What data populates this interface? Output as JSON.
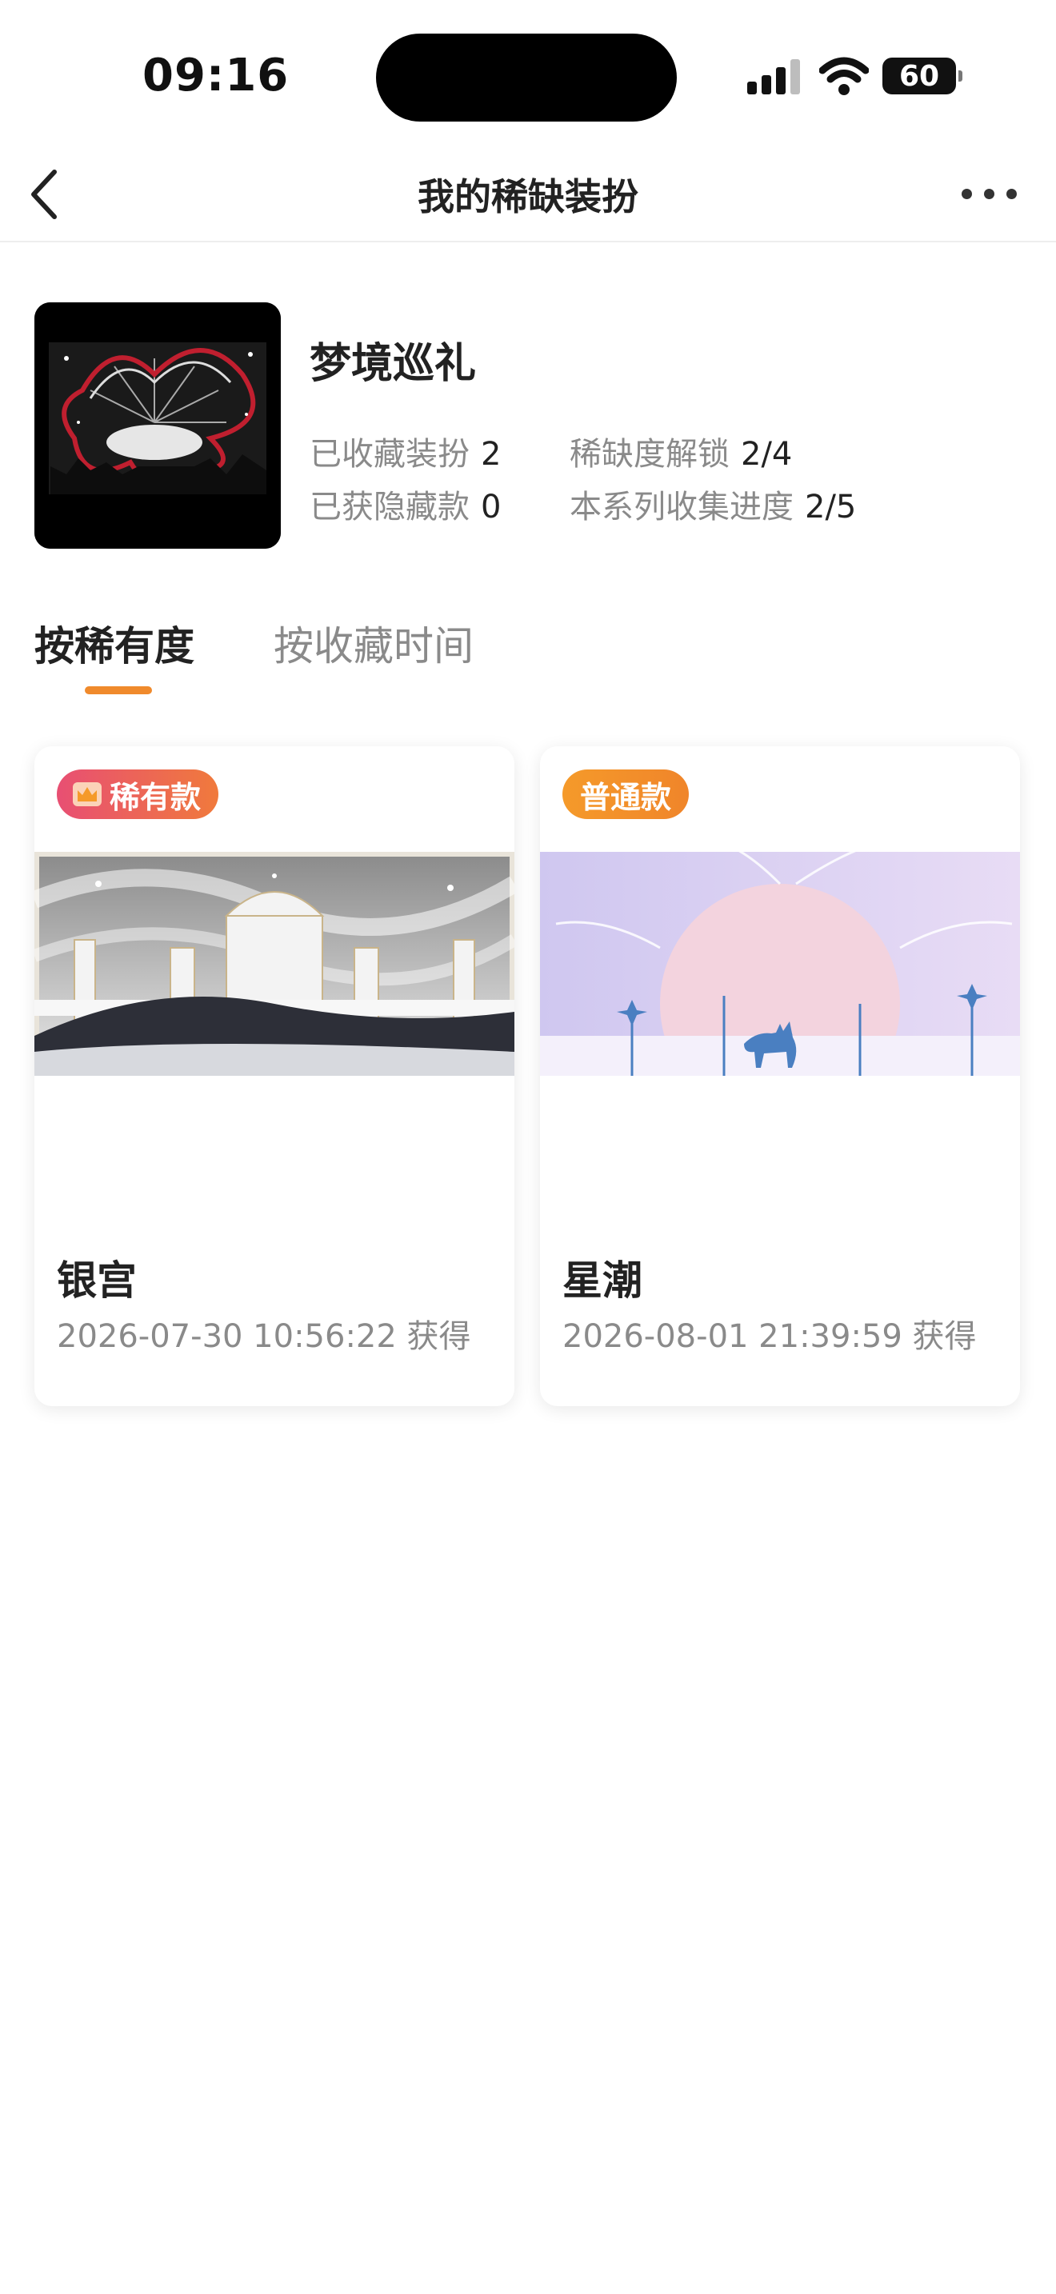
{
  "status_bar": {
    "time": "09:16",
    "battery": "60",
    "icons": [
      "signal-icon",
      "wifi-icon",
      "battery-icon"
    ]
  },
  "nav": {
    "title": "我的稀缺装扮",
    "back_icon": "chevron-left-icon",
    "more_icon": "more-dots-icon"
  },
  "series": {
    "name": "梦境巡礼",
    "stats": [
      {
        "label": "已收藏装扮",
        "value": "2"
      },
      {
        "label": "稀缺度解锁",
        "value": "2/4"
      },
      {
        "label": "已获隐藏款",
        "value": "0"
      },
      {
        "label": "本系列收集进度",
        "value": "2/5"
      }
    ]
  },
  "tabs": [
    {
      "label": "按稀有度",
      "active": true
    },
    {
      "label": "按收藏时间",
      "active": false
    }
  ],
  "colors": {
    "accent": "#f08a2c",
    "rare_badge": "#e84f73",
    "normal_badge": "#f59a2a",
    "muted_text": "#8a8a8a"
  },
  "items": [
    {
      "badge": "稀有款",
      "badge_icon": "crown-icon",
      "name": "银宫",
      "time": "2026-07-30 10:56:22 获得"
    },
    {
      "badge": "普通款",
      "name": "星潮",
      "time": "2026-08-01 21:39:59 获得"
    }
  ]
}
